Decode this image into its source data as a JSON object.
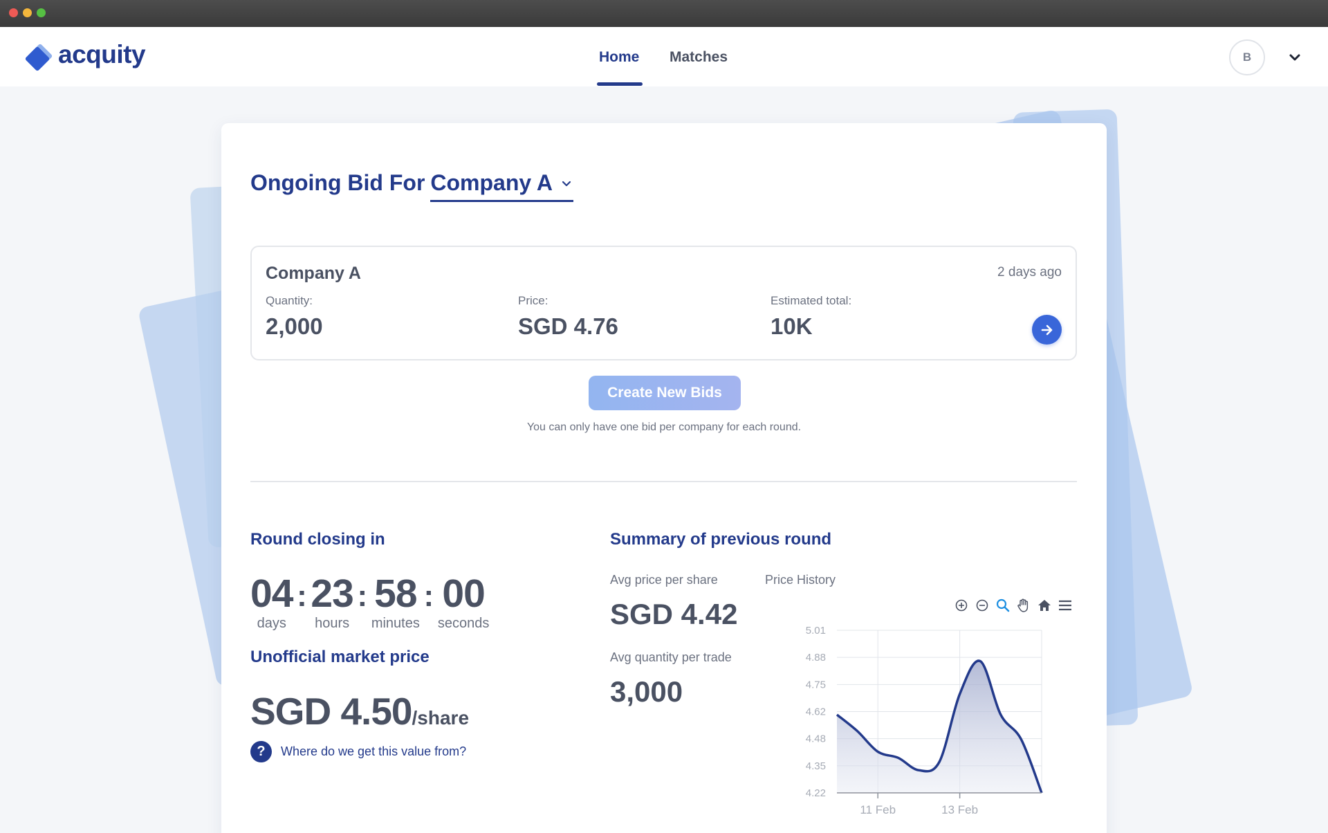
{
  "app": {
    "logo_text": "acquity"
  },
  "nav": {
    "items": [
      {
        "label": "Home"
      },
      {
        "label": "Matches"
      }
    ],
    "active": "Home",
    "avatar_initial": "B"
  },
  "heading": {
    "prefix": "Ongoing Bid For",
    "company": "Company A"
  },
  "bid": {
    "company": "Company A",
    "time": "2 days ago",
    "quantity_label": "Quantity:",
    "quantity": "2,000",
    "price_label": "Price:",
    "price": "SGD 4.76",
    "total_label": "Estimated total:",
    "total": "10K"
  },
  "create": {
    "button_label": "Create New Bids",
    "note": "You can only have one bid per company for each round."
  },
  "round": {
    "title": "Round closing in",
    "days": "04",
    "days_label": "days",
    "hours": "23",
    "hours_label": "hours",
    "minutes": "58",
    "minutes_label": "minutes",
    "seconds": "00",
    "seconds_label": "seconds",
    "separator": ":"
  },
  "market": {
    "title": "Unofficial market price",
    "value": "SGD 4.50",
    "unit": "/share",
    "help_icon": "?",
    "help_text": "Where do we get this value from?"
  },
  "summary": {
    "title": "Summary of previous round",
    "avg_price_label": "Avg price per share",
    "avg_price": "SGD 4.42",
    "avg_qty_label": "Avg quantity per trade",
    "avg_qty": "3,000"
  },
  "chart_title": "Price History",
  "chart_toolbar": [
    "zoom-in-icon",
    "zoom-out-icon",
    "magnifier-icon",
    "pan-hand-icon",
    "home-icon",
    "menu-icon"
  ],
  "colors": {
    "brand": "#233a8b",
    "accent": "#3966d9",
    "line": "#233a8b"
  },
  "chart_data": {
    "type": "area",
    "x": [
      "10 Feb",
      "10.5 Feb",
      "11 Feb",
      "11.5 Feb",
      "12 Feb",
      "12.5 Feb",
      "13 Feb",
      "13.5 Feb",
      "14 Feb",
      "14.5 Feb",
      "15 Feb"
    ],
    "y": [
      4.6,
      4.52,
      4.42,
      4.39,
      4.33,
      4.37,
      4.7,
      4.86,
      4.6,
      4.48,
      4.22
    ],
    "xticks": [
      "11 Feb",
      "13 Feb"
    ],
    "yticks": [
      "5.01",
      "4.88",
      "4.75",
      "4.62",
      "4.48",
      "4.35",
      "4.22"
    ],
    "ylim": [
      4.22,
      5.01
    ],
    "grid": true
  }
}
